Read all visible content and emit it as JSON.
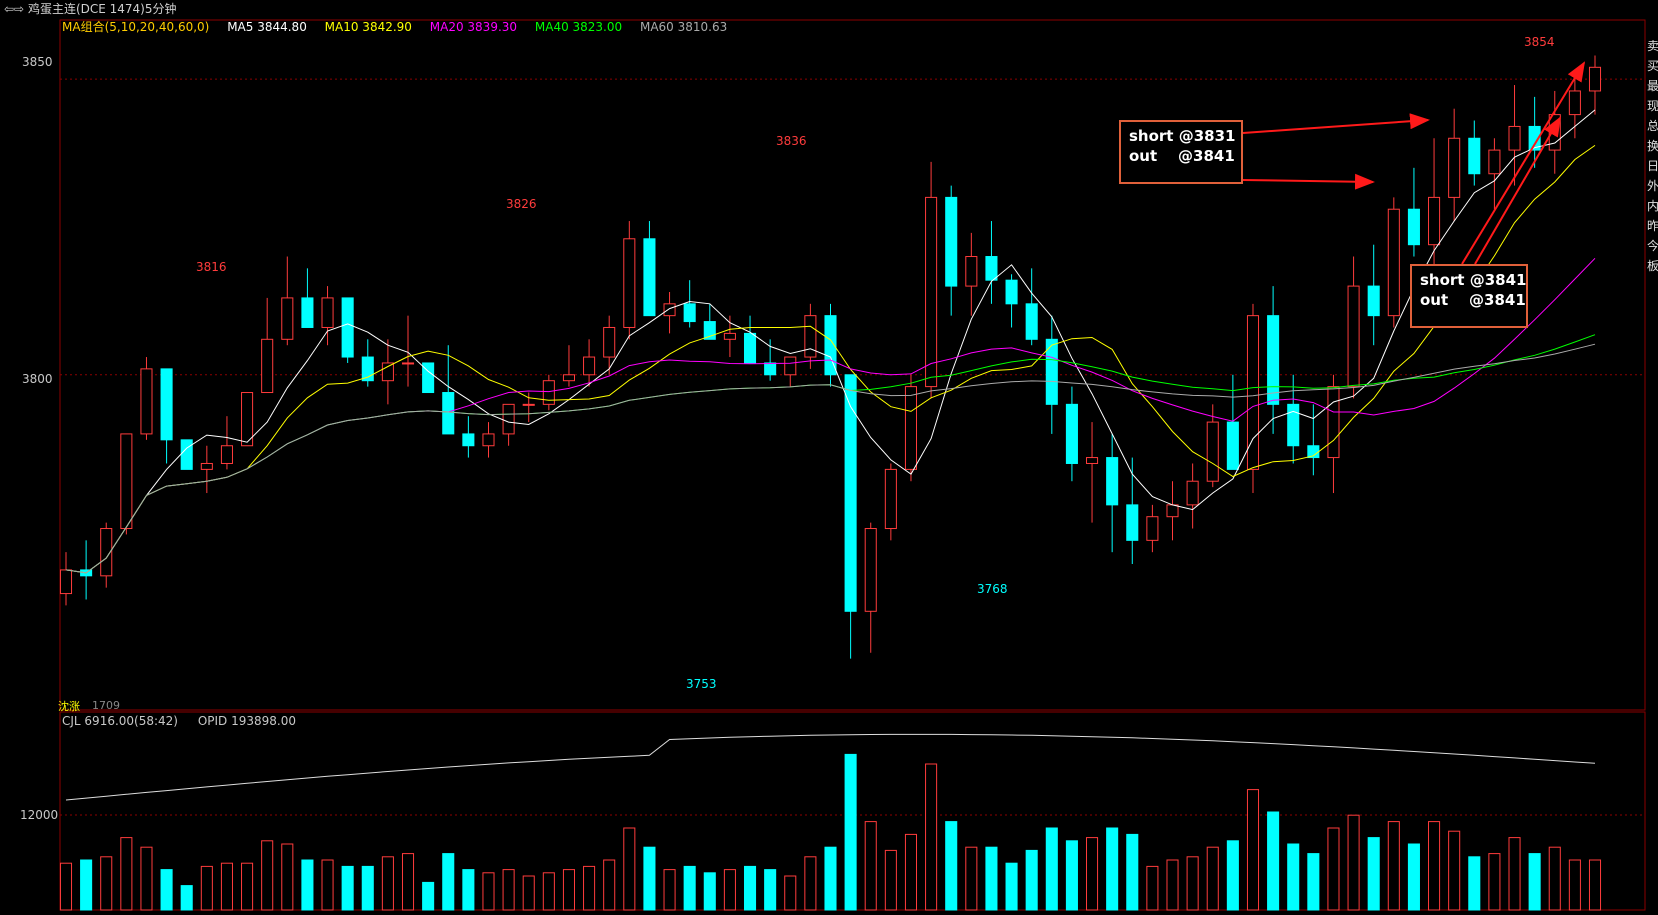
{
  "window": {
    "title": "鸡蛋主连(DCE 1474)5分钟",
    "nav_icon": "arrow-left-right-icon"
  },
  "ma_legend": {
    "group": "MA组合(5,10,20,40,60,0)",
    "items": [
      {
        "label": "MA5 3844.80",
        "color": "#ffffff"
      },
      {
        "label": "MA10 3842.90",
        "color": "#ffff00"
      },
      {
        "label": "MA20 3839.30",
        "color": "#ff00ff"
      },
      {
        "label": "MA40 3823.00",
        "color": "#00ff00"
      },
      {
        "label": "MA60 3810.63",
        "color": "#aaaaaa"
      }
    ]
  },
  "price_axis": {
    "top_label": "3850",
    "mid_label": "3800"
  },
  "volume_axis": {
    "label": "12000"
  },
  "volume_legend": {
    "cjl": "CJL  6916.00(58:42)",
    "opid": "OPID  193898.00"
  },
  "price_annotations": {
    "high_3816": "3816",
    "high_3826": "3826",
    "high_3836": "3836",
    "high_3854": "3854",
    "low_3753": "3753",
    "low_3768": "3768"
  },
  "bottom_left_label": "1709",
  "bottom_left_overlay": "沈涨",
  "trade_notes": [
    {
      "id": "note-1",
      "line1": "short @3831",
      "line2": "out    @3841"
    },
    {
      "id": "note-2",
      "line1": "short @3841",
      "line2": "out    @3841"
    }
  ],
  "right_side_text": "卖买最现总换日外内昨今板",
  "colors": {
    "up": "#ff3c3c",
    "down": "#00ffff",
    "grid": "#8b0000",
    "annotation_box": "#e0603a",
    "arrow": "#ff1a1a"
  },
  "chart_data": {
    "type": "candlestick",
    "timeframe": "5分钟",
    "ylim": [
      3745,
      3860
    ],
    "candles": [
      [
        3763,
        3770,
        3761,
        3767
      ],
      [
        3767,
        3772,
        3762,
        3766
      ],
      [
        3766,
        3775,
        3764,
        3774
      ],
      [
        3774,
        3790,
        3773,
        3790
      ],
      [
        3790,
        3803,
        3789,
        3801
      ],
      [
        3801,
        3792,
        3785,
        3789
      ],
      [
        3789,
        3786,
        3784,
        3784
      ],
      [
        3784,
        3788,
        3780,
        3785
      ],
      [
        3785,
        3793,
        3784,
        3788
      ],
      [
        3788,
        3797,
        3788,
        3797
      ],
      [
        3797,
        3813,
        3797,
        3806
      ],
      [
        3806,
        3820,
        3805,
        3813
      ],
      [
        3813,
        3818,
        3808,
        3808
      ],
      [
        3808,
        3815,
        3805,
        3813
      ],
      [
        3813,
        3810,
        3802,
        3803
      ],
      [
        3803,
        3806,
        3798,
        3799
      ],
      [
        3799,
        3806,
        3795,
        3802
      ],
      [
        3802,
        3810,
        3798,
        3802
      ],
      [
        3802,
        3800,
        3797,
        3797
      ],
      [
        3797,
        3805,
        3793,
        3790
      ],
      [
        3790,
        3793,
        3786,
        3788
      ],
      [
        3788,
        3792,
        3786,
        3790
      ],
      [
        3790,
        3795,
        3788,
        3795
      ],
      [
        3795,
        3797,
        3792,
        3795
      ],
      [
        3795,
        3800,
        3794,
        3799
      ],
      [
        3799,
        3805,
        3798,
        3800
      ],
      [
        3800,
        3806,
        3798,
        3803
      ],
      [
        3803,
        3810,
        3800,
        3808
      ],
      [
        3808,
        3826,
        3806,
        3823
      ],
      [
        3823,
        3826,
        3812,
        3810
      ],
      [
        3810,
        3814,
        3807,
        3812
      ],
      [
        3812,
        3816,
        3808,
        3809
      ],
      [
        3809,
        3812,
        3806,
        3806
      ],
      [
        3806,
        3810,
        3803,
        3807
      ],
      [
        3807,
        3810,
        3802,
        3802
      ],
      [
        3802,
        3806,
        3799,
        3800
      ],
      [
        3800,
        3803,
        3798,
        3803
      ],
      [
        3803,
        3812,
        3801,
        3810
      ],
      [
        3810,
        3812,
        3798,
        3800
      ],
      [
        3800,
        3795,
        3752,
        3760
      ],
      [
        3760,
        3775,
        3753,
        3774
      ],
      [
        3774,
        3785,
        3772,
        3784
      ],
      [
        3784,
        3800,
        3782,
        3798
      ],
      [
        3798,
        3836,
        3796,
        3830
      ],
      [
        3830,
        3832,
        3810,
        3815
      ],
      [
        3815,
        3824,
        3810,
        3820
      ],
      [
        3820,
        3826,
        3812,
        3816
      ],
      [
        3816,
        3817,
        3808,
        3812
      ],
      [
        3812,
        3818,
        3805,
        3806
      ],
      [
        3806,
        3810,
        3790,
        3795
      ],
      [
        3795,
        3798,
        3782,
        3785
      ],
      [
        3785,
        3792,
        3775,
        3786
      ],
      [
        3786,
        3790,
        3770,
        3778
      ],
      [
        3778,
        3786,
        3768,
        3772
      ],
      [
        3772,
        3778,
        3770,
        3776
      ],
      [
        3776,
        3782,
        3772,
        3778
      ],
      [
        3778,
        3785,
        3774,
        3782
      ],
      [
        3782,
        3795,
        3781,
        3792
      ],
      [
        3792,
        3800,
        3784,
        3784
      ],
      [
        3784,
        3812,
        3780,
        3810
      ],
      [
        3810,
        3815,
        3790,
        3795
      ],
      [
        3795,
        3800,
        3785,
        3788
      ],
      [
        3788,
        3795,
        3783,
        3786
      ],
      [
        3786,
        3800,
        3780,
        3798
      ],
      [
        3798,
        3820,
        3796,
        3815
      ],
      [
        3815,
        3822,
        3805,
        3810
      ],
      [
        3810,
        3830,
        3808,
        3828
      ],
      [
        3828,
        3835,
        3820,
        3822
      ],
      [
        3822,
        3840,
        3818,
        3830
      ],
      [
        3830,
        3845,
        3826,
        3840
      ],
      [
        3840,
        3843,
        3832,
        3834
      ],
      [
        3834,
        3840,
        3828,
        3838
      ],
      [
        3838,
        3849,
        3832,
        3842
      ],
      [
        3842,
        3847,
        3835,
        3838
      ],
      [
        3838,
        3848,
        3834,
        3844
      ],
      [
        3844,
        3850,
        3840,
        3848
      ],
      [
        3848,
        3854,
        3844,
        3852
      ]
    ],
    "ma_series": [
      {
        "name": "MA5",
        "value": 3844.8
      },
      {
        "name": "MA10",
        "value": 3842.9
      },
      {
        "name": "MA20",
        "value": 3839.3
      },
      {
        "name": "MA40",
        "value": 3823.0
      },
      {
        "name": "MA60",
        "value": 3810.63
      }
    ],
    "volume_ylabel": "12000"
  }
}
